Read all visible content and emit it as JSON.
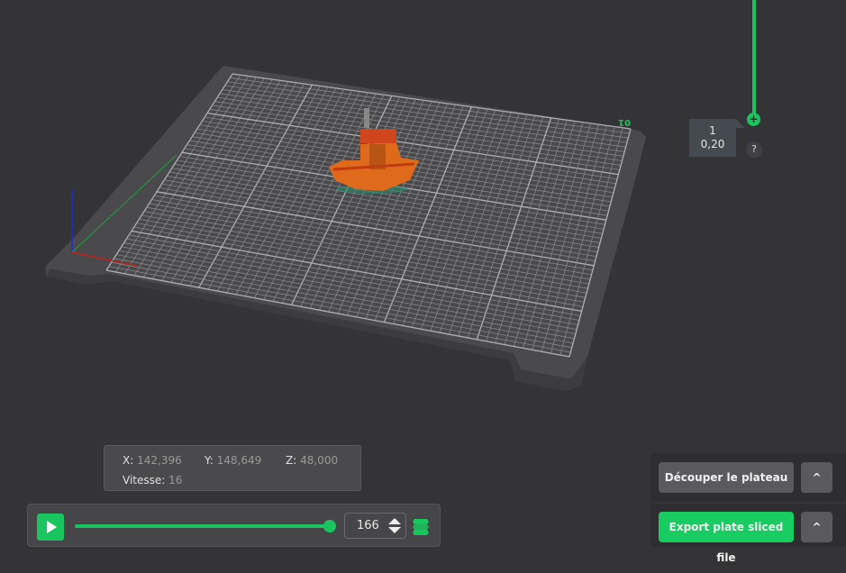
{
  "plate_label": "01",
  "layer_slider": {
    "layer": "1",
    "height": "0,20",
    "help": "?",
    "handle": "+"
  },
  "position": {
    "x_label": "X:",
    "x": "142,396",
    "y_label": "Y:",
    "y": "148,649",
    "z_label": "Z:",
    "z": "48,000",
    "speed_label": "Vitesse:",
    "speed": "16"
  },
  "playback": {
    "progress": 1.0,
    "layer_value": "166"
  },
  "actions": {
    "slice": "Découper le plateau",
    "export": "Export plate sliced file",
    "expand": "^"
  },
  "colors": {
    "accent": "#19c55f",
    "model": "#e06a1c"
  }
}
